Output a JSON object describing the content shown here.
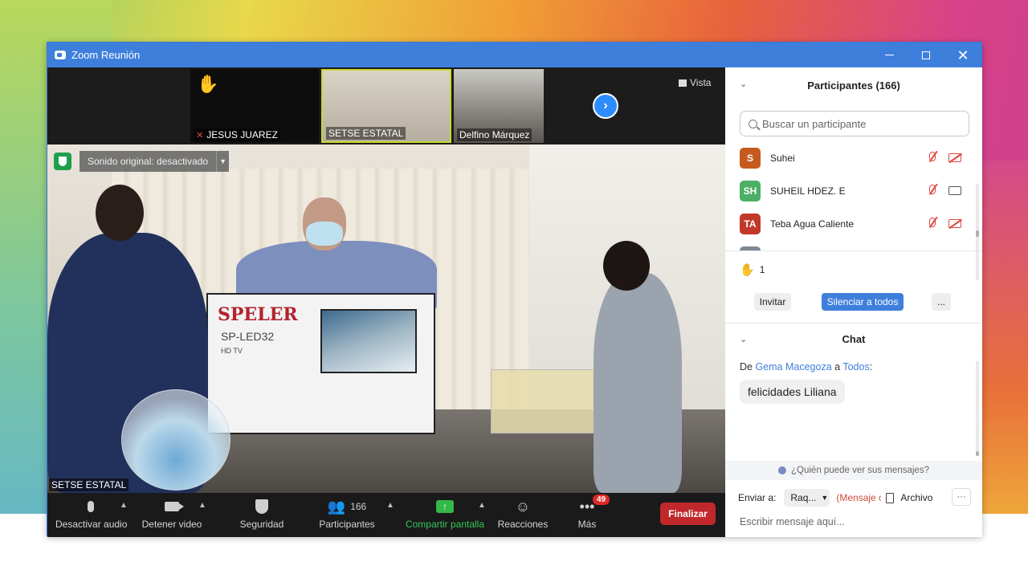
{
  "window": {
    "title": "Zoom Reunión",
    "controls": {
      "minimize": "—",
      "maximize": "□",
      "close": "✕"
    }
  },
  "gallery": {
    "thumbnails": [
      {
        "name": "JESUS JUAREZ",
        "hand_raised": true,
        "muted": true
      },
      {
        "name": "SETSE ESTATAL",
        "active": true
      },
      {
        "name": "Delfino Márquez"
      }
    ],
    "next_icon": "chevron-right-icon",
    "view_label": "Vista"
  },
  "main_video": {
    "sound_label": "Sonido original: desactivado",
    "speaker_name": "SETSE ESTATAL",
    "box_brand": "SPELER",
    "box_model": "SP-LED32",
    "box_model_sub": "HD TV"
  },
  "toolbar": {
    "audio_label": "Desactivar audio",
    "video_label": "Detener video",
    "security_label": "Seguridad",
    "participants_label": "Participantes",
    "participants_count": "166",
    "share_label": "Compartir pantalla",
    "reactions_label": "Reacciones",
    "more_label": "Más",
    "more_badge": "49",
    "end_label": "Finalizar"
  },
  "participants_panel": {
    "title": "Participantes (166)",
    "search_placeholder": "Buscar un participante",
    "items": [
      {
        "initials": "S",
        "name": "Suhei",
        "color": "#c65a1e",
        "mic": "muted",
        "video": "off"
      },
      {
        "initials": "SH",
        "name": "SUHEIL HDEZ. E",
        "color": "#4caf65",
        "mic": "muted",
        "video": "on"
      },
      {
        "initials": "TA",
        "name": "Teba Agua Caliente",
        "color": "#c0392b",
        "mic": "muted",
        "video": "off"
      }
    ],
    "raised_hands": "1",
    "invite_label": "Invitar",
    "mute_all_label": "Silenciar a todos",
    "more_label": "..."
  },
  "chat": {
    "title": "Chat",
    "from_prefix": "De",
    "from_name": "Gema Macegoza",
    "to_word": "a",
    "to_name": "Todos",
    "message": "felicidades Liliana",
    "who_can_see": "¿Quién puede ver sus mensajes?",
    "send_to_label": "Enviar a:",
    "send_to_value": "Raq...",
    "private_note": "(Mensaje c",
    "file_label": "Archivo",
    "more_label": "···",
    "input_placeholder": "Escribir mensaje aquí..."
  }
}
